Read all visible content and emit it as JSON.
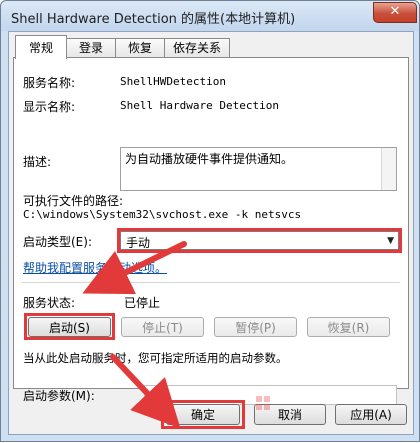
{
  "window": {
    "title": "Shell Hardware Detection 的属性(本地计算机)",
    "close_glyph": "✕"
  },
  "tabs": [
    {
      "label": "常规",
      "active": true
    },
    {
      "label": "登录",
      "active": false
    },
    {
      "label": "恢复",
      "active": false
    },
    {
      "label": "依存关系",
      "active": false
    }
  ],
  "general": {
    "service_name_label": "服务名称:",
    "service_name_value": "ShellHWDetection",
    "display_name_label": "显示名称:",
    "display_name_value": "Shell Hardware Detection",
    "description_label": "描述:",
    "description_value": "为自动播放硬件事件提供通知。",
    "exe_path_label": "可执行文件的路径:",
    "exe_path_value": "C:\\windows\\System32\\svchost.exe -k netsvcs",
    "startup_type_label": "启动类型(E):",
    "startup_type_value": "手动",
    "help_link": "帮助我配置服务启动选项。",
    "status_label": "服务状态:",
    "status_value": "已停止",
    "buttons": {
      "start": "启动(S)",
      "stop": "停止(T)",
      "pause": "暂停(P)",
      "resume": "恢复(R)"
    },
    "hint": "当从此处启动服务时，您可指定所适用的启动参数。",
    "params_label": "启动参数(M):",
    "params_value": ""
  },
  "footer": {
    "ok": "确定",
    "cancel": "取消",
    "apply": "应用(A)"
  },
  "colors": {
    "highlight": "#e23a3a",
    "link": "#0a4ea4",
    "title_bg": "#c3d6ee"
  },
  "icons": {
    "arrow": "red-arrow-annotation",
    "dropdown": "chevron-down-icon",
    "watermark": "system-house-logo"
  }
}
